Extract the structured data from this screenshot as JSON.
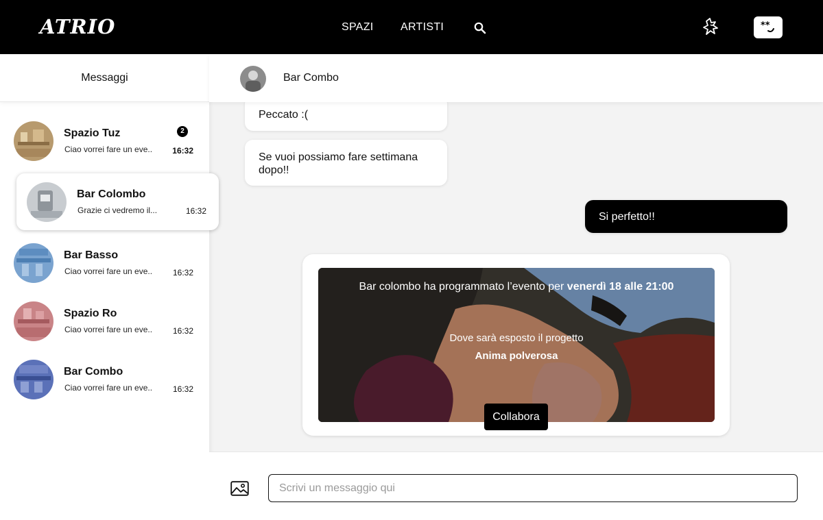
{
  "topbar": {
    "logo": "ATRIO",
    "nav": [
      {
        "label": "SPAZI"
      },
      {
        "label": "ARTISTI"
      }
    ],
    "icons": {
      "search": "search-icon",
      "collab": "collaboration-icon",
      "avatar": "face-avatar-icon"
    }
  },
  "sidebar": {
    "title": "Messaggi",
    "conversations": [
      {
        "name": "Spazio Tuz",
        "preview": "Ciao vorrei fare un eve..",
        "time": "16:32",
        "unread": "2",
        "tint": "#b79a6e"
      },
      {
        "name": "Bar Colombo",
        "preview": "Grazie ci vedremo il...",
        "time": "16:32",
        "tint": "#9ea3a8"
      },
      {
        "name": "Bar Basso",
        "preview": "Ciao vorrei fare un eve..",
        "time": "16:32",
        "tint": "#7aa3cf"
      },
      {
        "name": "Spazio Ro",
        "preview": "Ciao vorrei fare un eve..",
        "time": "16:32",
        "tint": "#c98487"
      },
      {
        "name": "Bar Combo",
        "preview": "Ciao vorrei fare un eve..",
        "time": "16:32",
        "tint": "#5b71b8"
      }
    ]
  },
  "chat": {
    "header_name": "Bar Combo",
    "messages": [
      {
        "text": "Peccato :(",
        "direction": "in"
      },
      {
        "text": "Se vuoi possiamo fare settimana dopo!!",
        "direction": "in"
      },
      {
        "text": "Si perfetto!!",
        "direction": "out"
      }
    ],
    "event": {
      "line1_prefix": "Bar colombo ha programmato l’evento per ",
      "line1_bold": "venerdì 18 alle 21:00",
      "line2": "Dove sarà esposto il progetto",
      "project": "Anima polverosa",
      "button": "Collabora"
    }
  },
  "composer": {
    "placeholder": "Scrivi un messaggio qui",
    "attach_icon": "image-icon"
  },
  "colors": {
    "accent": "#000000",
    "background": "#f3f3f3"
  }
}
